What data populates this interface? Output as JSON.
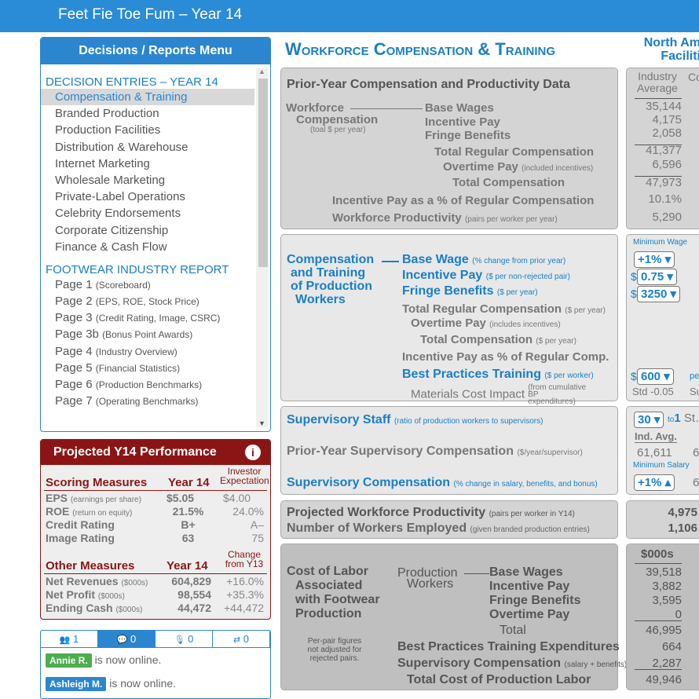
{
  "app": {
    "title": "Feet Fie Toe Fum – Year 14"
  },
  "menu": {
    "title": "Decisions / Reports Menu",
    "decisions_heading": "DECISION ENTRIES – YEAR 14",
    "decisions": [
      "Compensation & Training",
      "Branded Production",
      "Production Facilities",
      "Distribution & Warehouse",
      "Internet Marketing",
      "Wholesale Marketing",
      "Private-Label Operations",
      "Celebrity Endorsements",
      "Corporate Citizenship",
      "Finance & Cash Flow"
    ],
    "selected": "Compensation & Training",
    "reports_heading": "FOOTWEAR INDUSTRY REPORT",
    "reports": [
      {
        "page": "Page 1",
        "desc": "(Scoreboard)"
      },
      {
        "page": "Page 2",
        "desc": "(EPS, ROE, Stock Price)"
      },
      {
        "page": "Page 3",
        "desc": "(Credit Rating, Image, CSRC)"
      },
      {
        "page": "Page 3b",
        "desc": "(Bonus Point Awards)"
      },
      {
        "page": "Page 4",
        "desc": "(Industry Overview)"
      },
      {
        "page": "Page 5",
        "desc": "(Financial Statistics)"
      },
      {
        "page": "Page 6",
        "desc": "(Production Benchmarks)"
      },
      {
        "page": "Page 7",
        "desc": "(Operating Benchmarks)"
      }
    ]
  },
  "performance": {
    "title": "Projected Y14 Performance",
    "info_icon": "info-icon",
    "scoring_heading": "Scoring Measures",
    "year_col": "Year 14",
    "expect_col": "Investor Expectation",
    "scoring": [
      {
        "label": "EPS",
        "note": "(earnings per share)",
        "year": "$5.05",
        "expect": "$4.00"
      },
      {
        "label": "ROE",
        "note": "(return on equity)",
        "year": "21.5%",
        "expect": "24.0%"
      },
      {
        "label": "Credit Rating",
        "note": "",
        "year": "B+",
        "expect": "A–"
      },
      {
        "label": "Image Rating",
        "note": "",
        "year": "63",
        "expect": "75"
      }
    ],
    "other_heading": "Other Measures",
    "change_col": "Change from Y13",
    "other": [
      {
        "label": "Net Revenues",
        "note": "($000s)",
        "year": "604,829",
        "change": "+16.0%"
      },
      {
        "label": "Net Profit",
        "note": "($000s)",
        "year": "98,554",
        "change": "+35.3%"
      },
      {
        "label": "Ending Cash",
        "note": "($000s)",
        "year": "44,472",
        "change": "+44,472"
      }
    ]
  },
  "chat": {
    "tabs": [
      {
        "icon": "users-icon",
        "count": "1"
      },
      {
        "icon": "comments-icon",
        "count": "0"
      },
      {
        "icon": "microphone-icon",
        "count": "0"
      },
      {
        "icon": "retweet-icon",
        "count": "0"
      }
    ],
    "messages": [
      {
        "name": "Annie R.",
        "text": "is now online.",
        "color": "#4cae4c"
      },
      {
        "name": "Ashleigh M.",
        "text": "is now online.",
        "color": "#2b86cf"
      }
    ]
  },
  "main": {
    "title": "Workforce Compensation & Training",
    "right_title": "North Am… Faciliti…",
    "prior": {
      "heading": "Prior-Year Compensation and Productivity Data",
      "group": "Workforce",
      "group2": "Compensation",
      "group_note": "(toal $ per year)",
      "rows": [
        "Base Wages",
        "Incentive Pay",
        "Fringe Benefits",
        "Total Regular Compensation",
        "Overtime Pay",
        "Total Compensation",
        "Incentive Pay as a % of Regular Compensation",
        "Workforce Productivity"
      ],
      "overtime_note": "(included incentives)",
      "productivity_note": "(pairs per worker per year)",
      "col_header": "Industry Average",
      "col2_header": "Co…",
      "industry_avg": [
        "35,144",
        "4,175",
        "2,058",
        "41,377",
        "6,596",
        "47,973",
        "10.1%",
        "5,290"
      ]
    },
    "decisions": {
      "group": [
        "Compensation",
        "and Training",
        "of Production",
        "Workers"
      ],
      "base_wage": "Base Wage",
      "base_wage_note": "(% change from prior year)",
      "incentive": "Incentive Pay",
      "incentive_note": "($ per non-rejected pair)",
      "fringe": "Fringe Benefits",
      "fringe_note": "($ per year)",
      "total_reg": "Total Regular Compensation",
      "total_reg_note": "($ per year)",
      "overtime": "Overtime Pay",
      "overtime_note": "(includes incentives)",
      "total": "Total Compensation",
      "total_note": "($ per year)",
      "pct": "Incentive Pay as % of Regular Comp.",
      "bp": "Best Practices Training",
      "bp_note": "($ per worker)",
      "materials": "Materials Cost Impact",
      "materials_note": "(from cumulative BP expenditures)",
      "min_wage_label": "Minimum Wage",
      "base_wage_value": "+1%",
      "incentive_value": "0.75",
      "fringe_value": "3250",
      "bp_value": "600",
      "currency": "$",
      "bp_suffix": "pe…",
      "std": "Std -0.05",
      "std2": "Su…"
    },
    "supervisory": {
      "staff": "Supervisory Staff",
      "staff_note": "(ratio of production workers to supervisors)",
      "prior": "Prior-Year Supervisory Compensation",
      "prior_note": "($/year/supervisor)",
      "comp": "Supervisory Compensation",
      "comp_note": "(% change in salary, benefits, and bonus)",
      "ratio_value": "30",
      "ratio_suffix": "to",
      "ratio_one": "1",
      "ratio_trail": "St…",
      "ind_avg_label": "Ind. Avg.",
      "ind_avg": "61,611",
      "ind_avg2": "6…",
      "min_salary_label": "Minimum Salary",
      "comp_value": "+1%",
      "comp_trail": "6…"
    },
    "projected": {
      "productivity": "Projected Workforce Productivity",
      "productivity_note": "(pairs per worker in Y14)",
      "productivity_value": "4,975",
      "workers": "Number of Workers Employed",
      "workers_note": "(given branded production entries)",
      "workers_value": "1,106"
    },
    "labor": {
      "group": [
        "Cost of Labor",
        "Associated",
        "with Footwear",
        "Production"
      ],
      "sub": [
        "Production",
        "Workers"
      ],
      "note": "Per-pair figures not adjusted for rejected pairs.",
      "rows": [
        "Base Wages",
        "Incentive Pay",
        "Fringe Benefits",
        "Overtime Pay",
        "Total",
        "Best Practices Training Expenditures",
        "Supervisory Compensation",
        "Total Cost of Production Labor"
      ],
      "sup_note": "(salary + benefits)",
      "col_header": "$000s",
      "values": [
        "39,518",
        "3,882",
        "3,595",
        "0",
        "46,995",
        "664",
        "2,287",
        "49,946"
      ]
    }
  },
  "colors": {
    "header": "#2a8bd6",
    "accent": "#1a7fc6",
    "performance": "#8b1515"
  }
}
